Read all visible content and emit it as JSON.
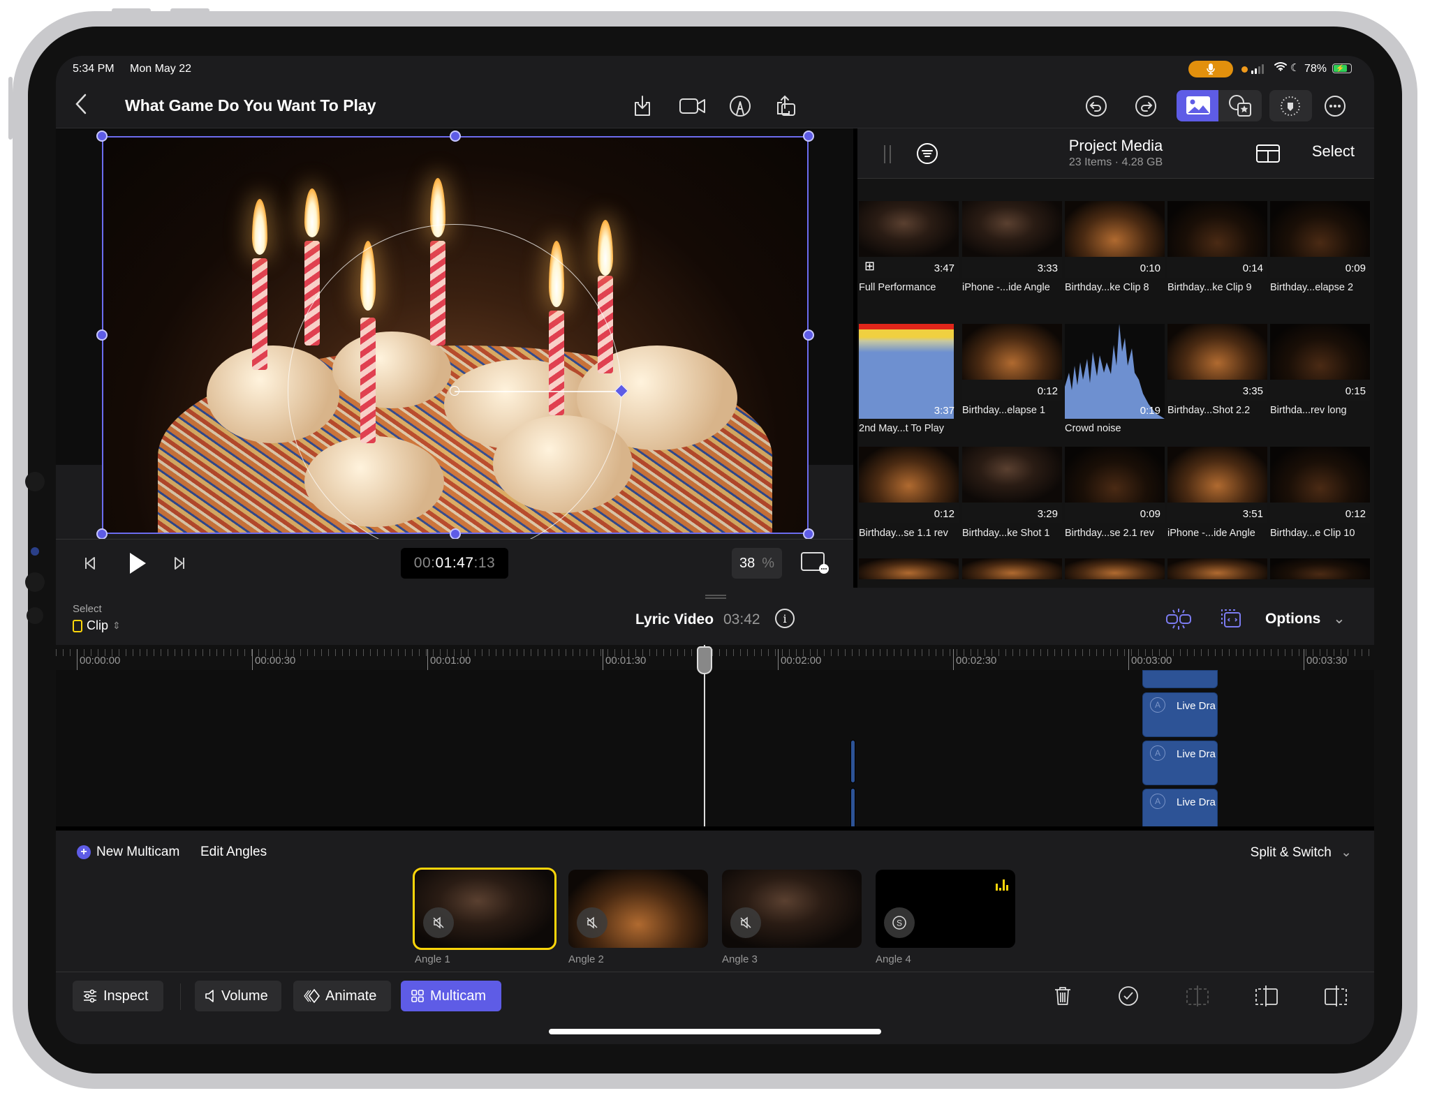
{
  "status_bar": {
    "time": "5:34 PM",
    "date": "Mon May 22",
    "battery_percent": "78%",
    "battery_level": 0.78,
    "icons": [
      "microphone-icon",
      "signal-icon",
      "wifi-icon",
      "focus-moon-icon",
      "battery-charging-icon"
    ]
  },
  "titlebar": {
    "back_icon": "chevron-left-icon",
    "project_title": "What Game Do You Want To Play",
    "center_icons": [
      "import-icon",
      "camera-icon",
      "live-drawing-icon",
      "share-icon"
    ],
    "right_icons": [
      "undo-icon",
      "redo-icon",
      "photos-icon",
      "media-library-icon",
      "voiceover-icon",
      "more-icon"
    ],
    "active_segment": "photos"
  },
  "viewer": {
    "timecode_dim_prefix": "00:",
    "timecode_main": "01:47",
    "timecode_dim_suffix": ":13",
    "zoom_value": "38",
    "zoom_unit": "%",
    "accent_color": "#5e5ce6"
  },
  "media_browser": {
    "title": "Project Media",
    "subtitle": "23 Items  ·  4.28 GB",
    "select_label": "Select",
    "items": [
      {
        "name": "Full Performance",
        "duration": "3:47",
        "style": "person",
        "multicam": true
      },
      {
        "name": "iPhone -...ide Angle",
        "duration": "3:33",
        "style": "person"
      },
      {
        "name": "Birthday...ke Clip 8",
        "duration": "0:10",
        "style": "warm"
      },
      {
        "name": "Birthday...ke Clip 9",
        "duration": "0:14",
        "style": "dim-warm"
      },
      {
        "name": "Birthday...elapse 2",
        "duration": "0:09",
        "style": "dim-warm"
      },
      {
        "name": "2nd May...t To Play",
        "duration": "3:37",
        "style": "audio-bg",
        "tall": true
      },
      {
        "name": "Birthday...elapse 1",
        "duration": "0:12",
        "style": "warm"
      },
      {
        "name": "Crowd noise",
        "duration": "0:19",
        "style": "wave",
        "tall": true
      },
      {
        "name": "Birthday...Shot 2.2",
        "duration": "3:35",
        "style": "warm"
      },
      {
        "name": "Birthda...rev long",
        "duration": "0:15",
        "style": "dim-warm"
      },
      {
        "name": "Birthday...se 1.1 rev",
        "duration": "0:12",
        "style": "warm"
      },
      {
        "name": "Birthday...ke Shot 1",
        "duration": "3:29",
        "style": "person"
      },
      {
        "name": "Birthday...se 2.1 rev",
        "duration": "0:09",
        "style": "dim-warm"
      },
      {
        "name": "iPhone -...ide Angle",
        "duration": "3:51",
        "style": "warm"
      },
      {
        "name": "Birthday...e Clip 10",
        "duration": "0:12",
        "style": "dim-warm"
      }
    ]
  },
  "timeline_header": {
    "select_label": "Select",
    "selection_mode": "Clip",
    "project_name": "Lyric Video",
    "project_duration": "03:42",
    "options_label": "Options"
  },
  "timeline": {
    "ruler_labels": [
      "00:00:00",
      "00:00:30",
      "00:01:00",
      "00:01:30",
      "00:02:00",
      "00:02:30",
      "00:03:00",
      "00:03:30"
    ],
    "playhead_time": "00:01:47:13",
    "clips": [
      {
        "label": "",
        "kind": "top-partial"
      },
      {
        "label": "Live Drawing",
        "kind": "live-drawing"
      },
      {
        "label": "Live Drawing",
        "kind": "live-drawing"
      },
      {
        "label": "Live Drawing",
        "kind": "live-drawing"
      }
    ]
  },
  "multicam": {
    "new_label": "New Multicam",
    "edit_label": "Edit Angles",
    "mode_label": "Split & Switch",
    "angles": [
      {
        "label": "Angle 1",
        "selected": true,
        "audio": "muted",
        "style": "person"
      },
      {
        "label": "Angle 2",
        "selected": false,
        "audio": "muted",
        "style": "warm"
      },
      {
        "label": "Angle 3",
        "selected": false,
        "audio": "muted",
        "style": "person"
      },
      {
        "label": "Angle 4",
        "selected": false,
        "audio": "solo",
        "style": "black",
        "meter": true
      }
    ]
  },
  "toolbar": {
    "inspect_label": "Inspect",
    "volume_label": "Volume",
    "animate_label": "Animate",
    "multicam_label": "Multicam",
    "right_icons": [
      "trash-icon",
      "checkmark-icon",
      "split-icon",
      "trim-start-icon",
      "trim-end-icon"
    ]
  }
}
